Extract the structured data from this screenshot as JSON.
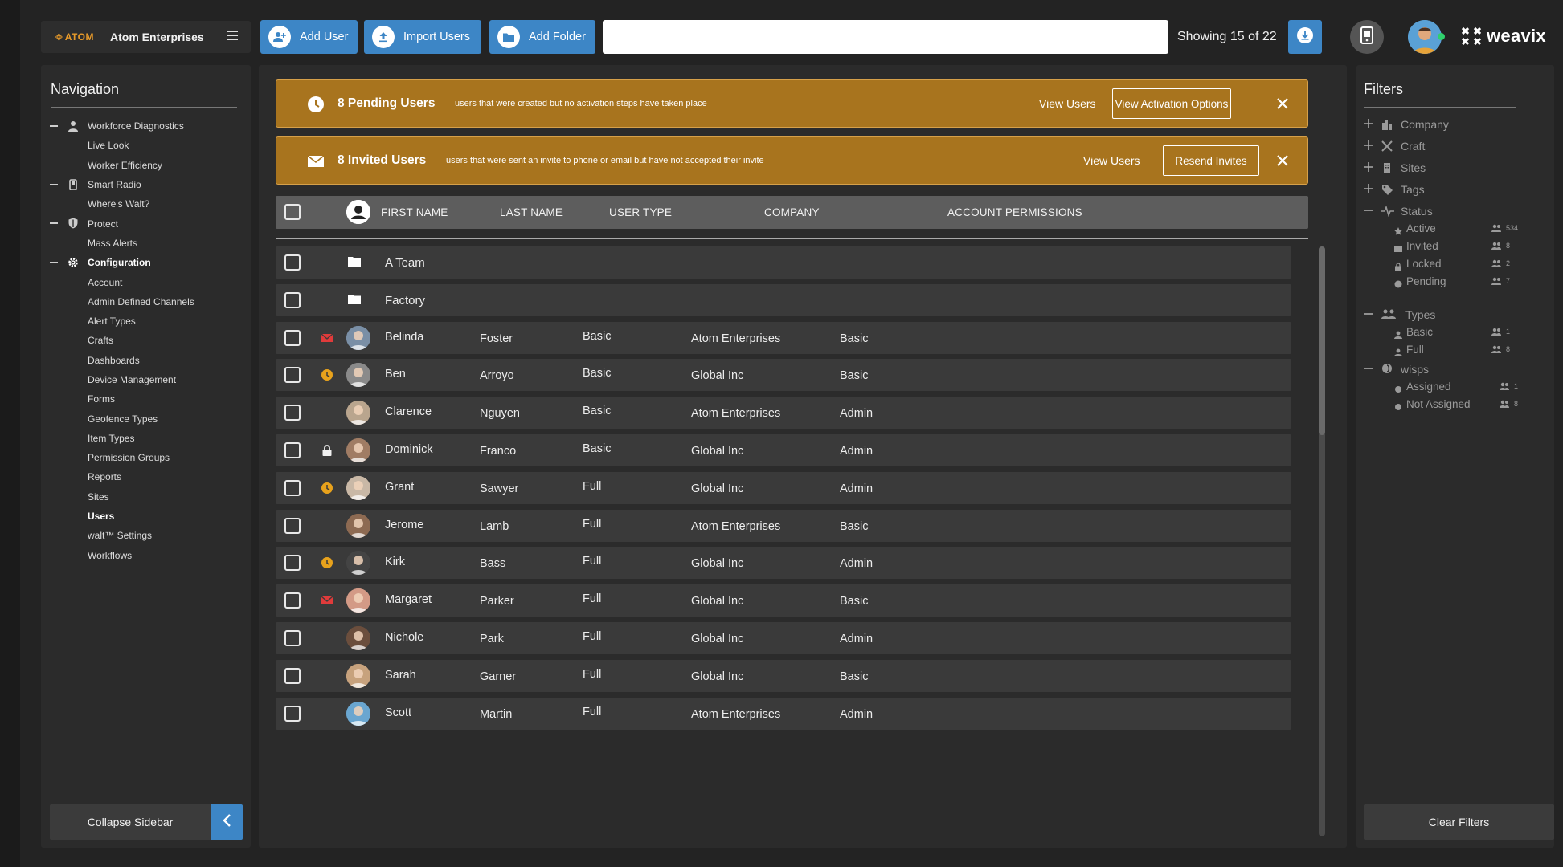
{
  "brand": {
    "logo_text": "ATOM",
    "company": "Atom Enterprises"
  },
  "toolbar": {
    "add_user": "Add User",
    "import_users": "Import Users",
    "add_folder": "Add Folder",
    "search_value": "",
    "showing": "Showing 15 of 22",
    "brand_logo": "weavix"
  },
  "nav": {
    "title": "Navigation",
    "items": [
      {
        "label": "Workforce Diagnostics",
        "kind": "parent",
        "icon": "person-icon"
      },
      {
        "label": "Live Look",
        "kind": "child"
      },
      {
        "label": "Worker Efficiency",
        "kind": "child"
      },
      {
        "label": "Smart Radio",
        "kind": "parent",
        "icon": "radio-icon"
      },
      {
        "label": "Where's Walt?",
        "kind": "child"
      },
      {
        "label": "Protect",
        "kind": "parent",
        "icon": "shield-icon"
      },
      {
        "label": "Mass Alerts",
        "kind": "child"
      },
      {
        "label": "Configuration",
        "kind": "parent",
        "icon": "gear-icon",
        "bold": true
      },
      {
        "label": "Account",
        "kind": "child"
      },
      {
        "label": "Admin Defined Channels",
        "kind": "child"
      },
      {
        "label": "Alert Types",
        "kind": "child"
      },
      {
        "label": "Crafts",
        "kind": "child"
      },
      {
        "label": "Dashboards",
        "kind": "child"
      },
      {
        "label": "Device Management",
        "kind": "child"
      },
      {
        "label": "Forms",
        "kind": "child"
      },
      {
        "label": "Geofence Types",
        "kind": "child"
      },
      {
        "label": "Item Types",
        "kind": "child"
      },
      {
        "label": "Permission Groups",
        "kind": "child"
      },
      {
        "label": "Reports",
        "kind": "child"
      },
      {
        "label": "Sites",
        "kind": "child"
      },
      {
        "label": "Users",
        "kind": "child",
        "bold": true
      },
      {
        "label": "walt™ Settings",
        "kind": "child"
      },
      {
        "label": "Workflows",
        "kind": "child"
      }
    ],
    "collapse_label": "Collapse Sidebar"
  },
  "banners": {
    "pending": {
      "title": "8 Pending Users",
      "desc": "users that were created but no activation steps have taken place",
      "view": "View Users",
      "action": "View Activation Options"
    },
    "invited": {
      "title": "8 Invited Users",
      "desc": "users that were sent an invite to phone or email but have not accepted their invite",
      "view": "View Users",
      "action": "Resend Invites"
    }
  },
  "table": {
    "headers": {
      "first_name": "FIRST NAME",
      "last_name": "LAST NAME",
      "user_type": "USER TYPE",
      "company": "COMPANY",
      "permissions": "ACCOUNT PERMISSIONS"
    },
    "folders": [
      "A Team",
      "Factory"
    ],
    "rows": [
      {
        "status": "invited",
        "first": "Belinda",
        "last": "Foster",
        "type": "Basic",
        "company": "Atom Enterprises",
        "perm": "Basic",
        "avatar_color": "#7a8fa6"
      },
      {
        "status": "pending",
        "first": "Ben",
        "last": "Arroyo",
        "type": "Basic",
        "company": "Global Inc",
        "perm": "Basic",
        "avatar_color": "#8a8a8a"
      },
      {
        "status": "",
        "first": "Clarence",
        "last": "Nguyen",
        "type": "Basic",
        "company": "Atom Enterprises",
        "perm": "Admin",
        "avatar_color": "#b9a58e"
      },
      {
        "status": "locked",
        "first": "Dominick",
        "last": "Franco",
        "type": "Basic",
        "company": "Global Inc",
        "perm": "Admin",
        "avatar_color": "#a07c64"
      },
      {
        "status": "pending",
        "first": "Grant",
        "last": "Sawyer",
        "type": "Full",
        "company": "Global Inc",
        "perm": "Admin",
        "avatar_color": "#c9b8a6"
      },
      {
        "status": "",
        "first": "Jerome",
        "last": "Lamb",
        "type": "Full",
        "company": "Atom Enterprises",
        "perm": "Basic",
        "avatar_color": "#8d6a52"
      },
      {
        "status": "pending",
        "first": "Kirk",
        "last": "Bass",
        "type": "Full",
        "company": "Global Inc",
        "perm": "Admin",
        "avatar_color": "#444444"
      },
      {
        "status": "invited",
        "first": "Margaret",
        "last": "Parker",
        "type": "Full",
        "company": "Global Inc",
        "perm": "Basic",
        "avatar_color": "#d39a86"
      },
      {
        "status": "",
        "first": "Nichole",
        "last": "Park",
        "type": "Full",
        "company": "Global Inc",
        "perm": "Admin",
        "avatar_color": "#6b4e3d"
      },
      {
        "status": "",
        "first": "Sarah",
        "last": "Garner",
        "type": "Full",
        "company": "Global Inc",
        "perm": "Basic",
        "avatar_color": "#c7a27d"
      },
      {
        "status": "",
        "first": "Scott",
        "last": "Martin",
        "type": "Full",
        "company": "Atom Enterprises",
        "perm": "Admin",
        "avatar_color": "#6aa6d0"
      }
    ]
  },
  "filters": {
    "title": "Filters",
    "groups": {
      "company": "Company",
      "craft": "Craft",
      "sites": "Sites",
      "tags": "Tags",
      "status": "Status",
      "types": "Types",
      "wisps": "wisps"
    },
    "status_items": [
      {
        "label": "Active",
        "count": "534",
        "icon": "star-icon"
      },
      {
        "label": "Invited",
        "count": "8",
        "icon": "envelope-icon"
      },
      {
        "label": "Locked",
        "count": "2",
        "icon": "lock-icon"
      },
      {
        "label": "Pending",
        "count": "7",
        "icon": "clock-icon"
      }
    ],
    "type_items": [
      {
        "label": "Basic",
        "count": "1"
      },
      {
        "label": "Full",
        "count": "8"
      }
    ],
    "wisp_items": [
      {
        "label": "Assigned",
        "count": "1"
      },
      {
        "label": "Not Assigned",
        "count": "8"
      }
    ],
    "clear_label": "Clear Filters"
  },
  "colors": {
    "accent": "#3d86c6",
    "banner": "#a8741e",
    "pending": "#e8a21c",
    "invited": "#e03b3b"
  }
}
